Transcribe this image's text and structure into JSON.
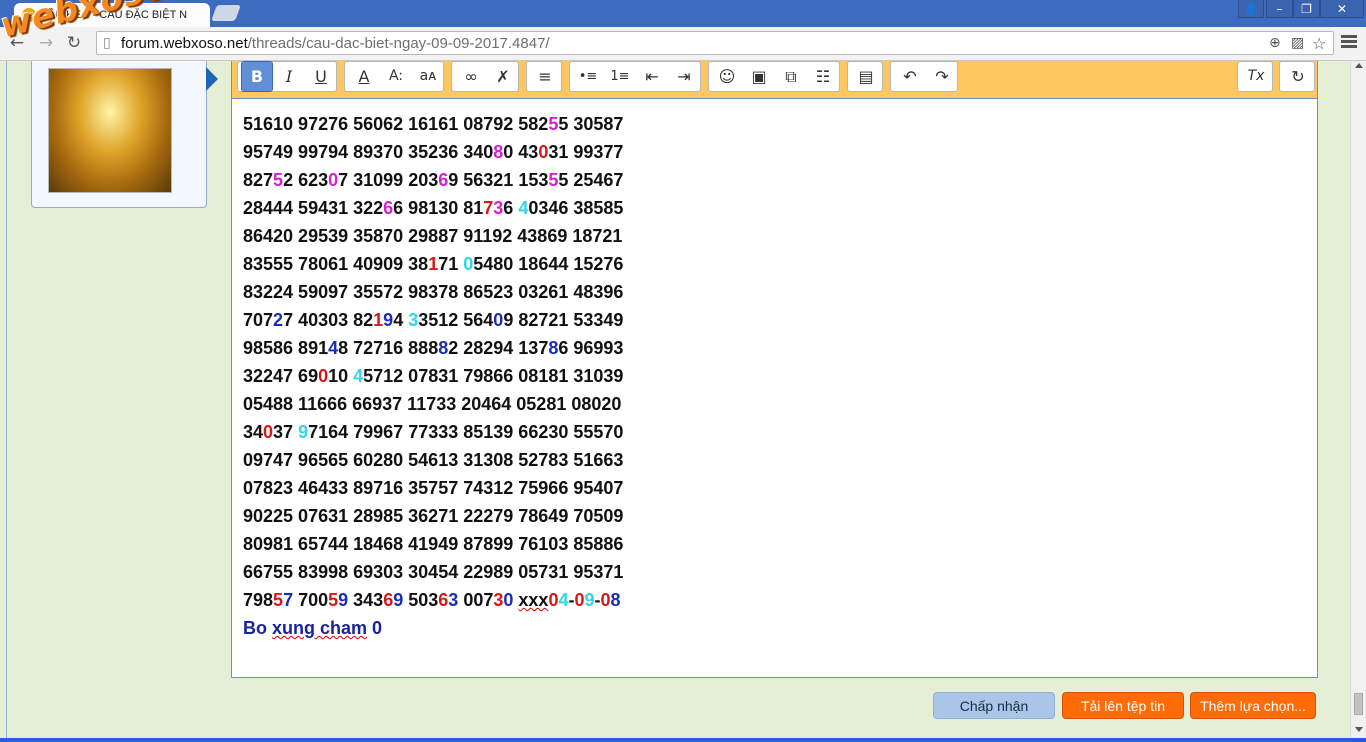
{
  "browser": {
    "tab_title": "CẦU KÈO - CẦU ĐẶC BIỆT N",
    "tab_favicon": "XS",
    "url_host": "forum.webxoso.net",
    "url_path": "/threads/cau-dac-biet-ngay-09-09-2017.4847/",
    "icons": {
      "back": "back-arrow-icon",
      "forward": "forward-arrow-icon",
      "reload": "reload-icon",
      "zoom": "zoom-icon",
      "translate": "translate-icon",
      "star": "star-icon",
      "menu": "menu-icon"
    }
  },
  "watermark": "webxoso.net",
  "editor": {
    "toolbar_icons": [
      "bold-icon",
      "italic-icon",
      "underline-icon",
      "font-color-icon",
      "font-size-icon",
      "font-family-icon",
      "link-icon",
      "unlink-icon",
      "align-icon",
      "bulleted-list-icon",
      "numbered-list-icon",
      "outdent-icon",
      "indent-icon",
      "smilie-icon",
      "image-icon",
      "media-icon",
      "quote-icon",
      "save-draft-icon",
      "undo-icon",
      "redo-icon",
      "remove-format-icon",
      "toggle-bbcode-icon"
    ],
    "toolbar_glyphs": {
      "bold": "B",
      "italic": "I",
      "underline": "U",
      "font_color": "A",
      "font_size": "A:",
      "font_family": "aᴀ",
      "link": "∞",
      "unlink": "✗",
      "align": "≡",
      "bullets": "•≡",
      "numbers": "1≡",
      "outdent": "⇤",
      "indent": "⇥",
      "smilie": "☺",
      "image": "▣",
      "media": "⧉",
      "quote": "☷",
      "save": "▤",
      "undo": "↶",
      "redo": "↷",
      "remove_format": "Tx",
      "toggle": "↻"
    },
    "lines": [
      [
        [
          "51610 97276 56062 16161 08792 582",
          ""
        ],
        [
          "5",
          "m"
        ],
        [
          "5 30587",
          ""
        ]
      ],
      [
        [
          "95749 99794 89370 35236 340",
          ""
        ],
        [
          "8",
          "m"
        ],
        [
          "0 43",
          ""
        ],
        [
          "0",
          "r"
        ],
        [
          "31 99377",
          ""
        ]
      ],
      [
        [
          "827",
          ""
        ],
        [
          "5",
          "m"
        ],
        [
          "2 623",
          ""
        ],
        [
          "0",
          "m"
        ],
        [
          "7 31099 203",
          ""
        ],
        [
          "6",
          "m"
        ],
        [
          "9 56321 153",
          ""
        ],
        [
          "5",
          "m"
        ],
        [
          "5 25467",
          ""
        ]
      ],
      [
        [
          "28444 59431 322",
          ""
        ],
        [
          "6",
          "m"
        ],
        [
          "6 98130 81",
          ""
        ],
        [
          "7",
          "r"
        ],
        [
          "3",
          "m"
        ],
        [
          "6 ",
          ""
        ],
        [
          "4",
          "c"
        ],
        [
          "0346 38585",
          ""
        ]
      ],
      [
        [
          "86420 29539 35870 29887 91192 43869 18721",
          ""
        ]
      ],
      [
        [
          "83555 78061 40909 38",
          ""
        ],
        [
          "1",
          "r"
        ],
        [
          "71 ",
          ""
        ],
        [
          "0",
          "c"
        ],
        [
          "5480 18644 15276",
          ""
        ]
      ],
      [
        [
          "83224 59097 35572 98378 86523 03261 48396",
          ""
        ]
      ],
      [
        [
          "707",
          ""
        ],
        [
          "2",
          "b"
        ],
        [
          "7 40303 82",
          ""
        ],
        [
          "1",
          "r"
        ],
        [
          "9",
          "b"
        ],
        [
          "4 ",
          ""
        ],
        [
          "3",
          "c"
        ],
        [
          "3512 564",
          ""
        ],
        [
          "0",
          "b"
        ],
        [
          "9 82721 53349",
          ""
        ]
      ],
      [
        [
          "98586 891",
          ""
        ],
        [
          "4",
          "b"
        ],
        [
          "8 72716 888",
          ""
        ],
        [
          "8",
          "b"
        ],
        [
          "2 28294 137",
          ""
        ],
        [
          "8",
          "b"
        ],
        [
          "6 96993",
          ""
        ]
      ],
      [
        [
          "32247 69",
          ""
        ],
        [
          "0",
          "r"
        ],
        [
          "10 ",
          ""
        ],
        [
          "4",
          "c"
        ],
        [
          "5712 07831 79866 08181 31039",
          ""
        ]
      ],
      [
        [
          "05488 11666 66937 11733 20464 05281 08020",
          ""
        ]
      ],
      [
        [
          "34",
          ""
        ],
        [
          "0",
          "r"
        ],
        [
          "37 ",
          ""
        ],
        [
          "9",
          "c"
        ],
        [
          "7164 79967 77333 85139 66230 55570",
          ""
        ]
      ],
      [
        [
          "09747 96565 60280 54613 31308 52783 51663",
          ""
        ]
      ],
      [
        [
          "07823 46433 89716 35757 74312 75966 95407",
          ""
        ]
      ],
      [
        [
          "90225 07631 28985 36271 22279 78649 70509",
          ""
        ]
      ],
      [
        [
          "80981 65744 18468 41949 87899 76103 85886",
          ""
        ]
      ],
      [
        [
          "66755 83998 69303 30454 22989 05731 95371",
          ""
        ]
      ],
      [
        [
          "798",
          ""
        ],
        [
          "5",
          "r"
        ],
        [
          "7",
          "b"
        ],
        [
          " 700",
          ""
        ],
        [
          "5",
          "r"
        ],
        [
          "9",
          "b"
        ],
        [
          " 343",
          ""
        ],
        [
          "6",
          "r"
        ],
        [
          "9",
          "b"
        ],
        [
          " 503",
          ""
        ],
        [
          "6",
          "r"
        ],
        [
          "3",
          "b"
        ],
        [
          " 007",
          ""
        ],
        [
          "3",
          "r"
        ],
        [
          "0",
          "b"
        ],
        [
          " ",
          ""
        ],
        [
          "xxx",
          "sq"
        ],
        [
          "0",
          "r"
        ],
        [
          "4",
          "c"
        ],
        [
          "-",
          ""
        ],
        [
          "0",
          "r"
        ],
        [
          "9",
          "c"
        ],
        [
          "-",
          ""
        ],
        [
          "0",
          "r"
        ],
        [
          "8",
          "b"
        ]
      ]
    ],
    "bo_xung_prefix": "Bo ",
    "bo_xung_squiggly": "xung cham",
    "bo_xung_suffix": " 0"
  },
  "buttons": {
    "accept": "Chấp nhận",
    "upload": "Tải lên tệp tin",
    "more": "Thêm lựa chọn..."
  }
}
